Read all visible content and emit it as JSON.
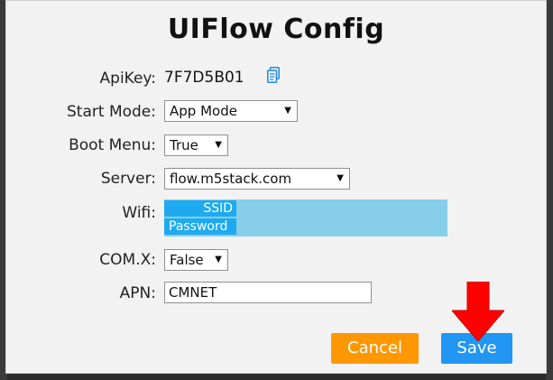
{
  "dialog": {
    "title": "UIFlow Config"
  },
  "fields": {
    "apikey": {
      "label": "ApiKey:",
      "value": "7F7D5B01",
      "icon": "copy-icon"
    },
    "start_mode": {
      "label": "Start Mode:",
      "selected": "App Mode"
    },
    "boot_menu": {
      "label": "Boot Menu:",
      "selected": "True"
    },
    "server": {
      "label": "Server:",
      "selected": "flow.m5stack.com"
    },
    "wifi": {
      "label": "Wifi:",
      "ssid_placeholder": "SSID",
      "password_placeholder": "Password"
    },
    "comx": {
      "label": "COM.X:",
      "selected": "False"
    },
    "apn": {
      "label": "APN:",
      "value": "CMNET"
    }
  },
  "buttons": {
    "cancel_label": "Cancel",
    "save_label": "Save"
  },
  "colors": {
    "cancel": "#ff9800",
    "save": "#2196f3",
    "wifi_area": "#87ceeb",
    "wifi_field": "#1ea9f0",
    "annotation_arrow": "#ff0000"
  }
}
